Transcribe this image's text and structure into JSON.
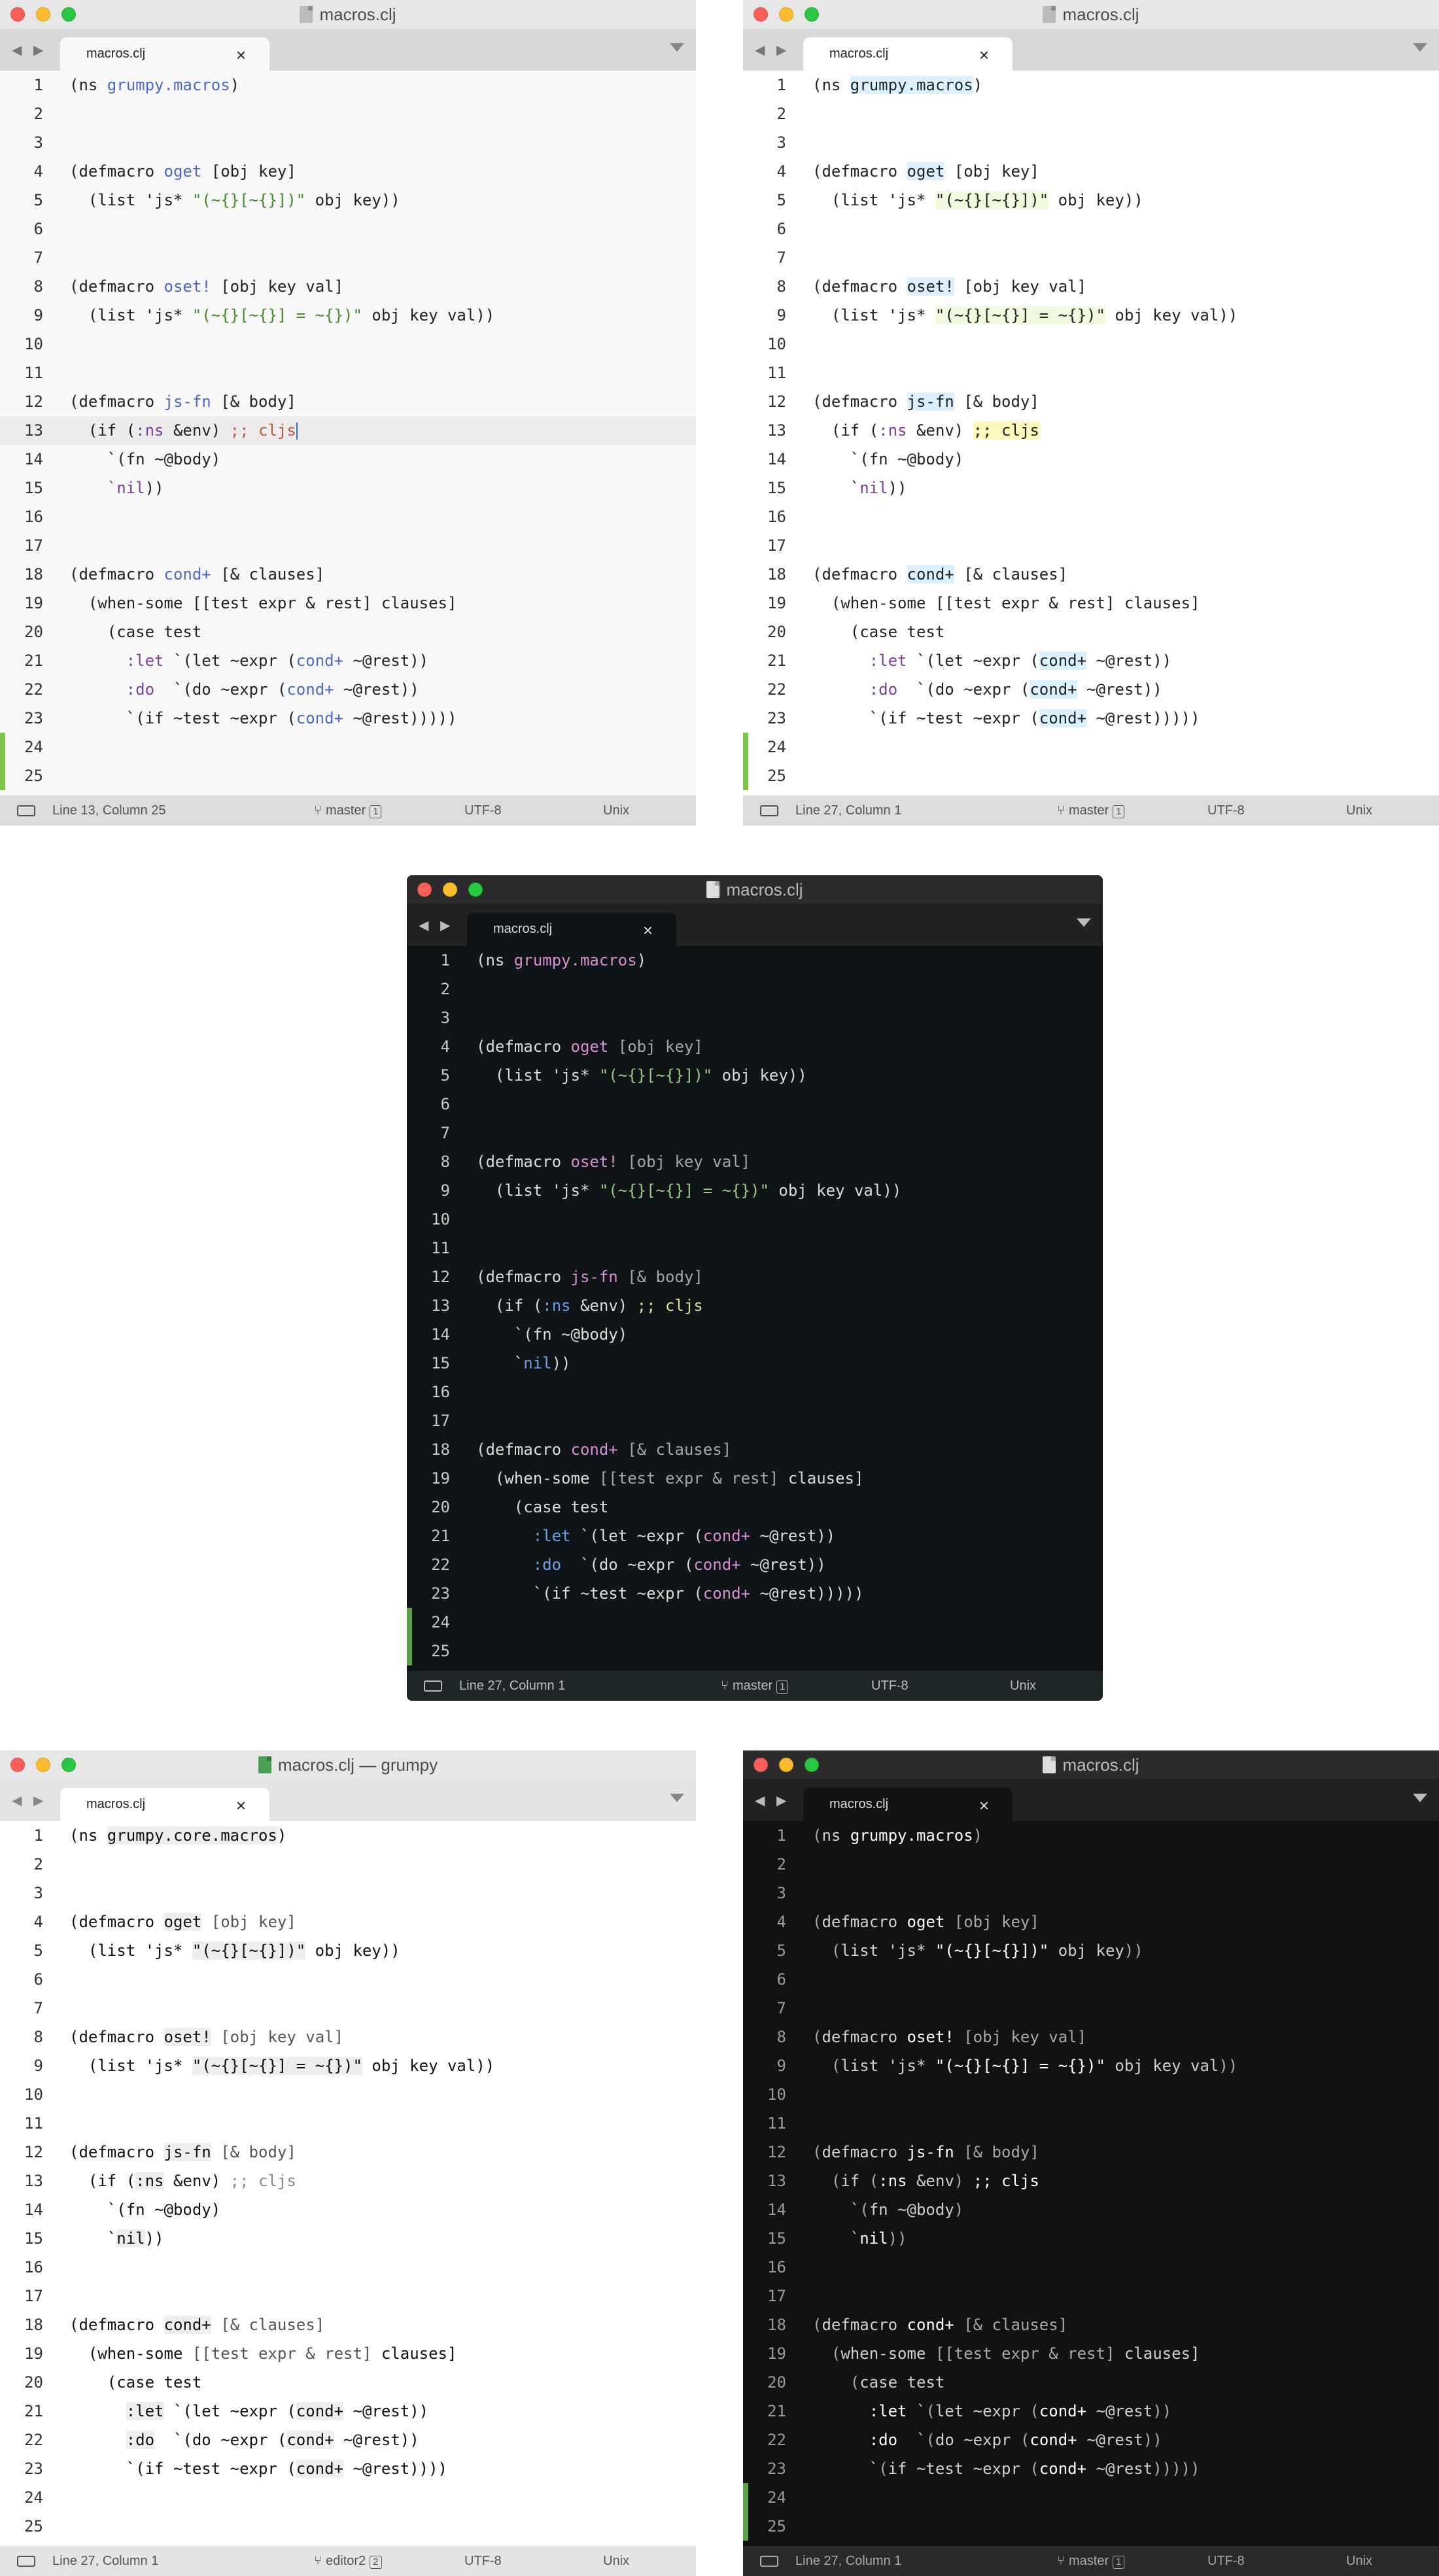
{
  "line_numbers": [
    "1",
    "2",
    "3",
    "4",
    "5",
    "6",
    "7",
    "8",
    "9",
    "10",
    "11",
    "12",
    "13",
    "14",
    "15",
    "16",
    "17",
    "18",
    "19",
    "20",
    "21",
    "22",
    "23",
    "24",
    "25"
  ],
  "code_default": [
    "(ns grumpy.macros)",
    "",
    "",
    "(defmacro oget [obj key]",
    "  (list 'js* \"(~{}[~{}])\" obj key))",
    "",
    "",
    "(defmacro oset! [obj key val]",
    "  (list 'js* \"(~{}[~{}] = ~{})\" obj key val))",
    "",
    "",
    "(defmacro js-fn [& body]",
    "  (if (:ns &env) ;; cljs",
    "    `(fn ~@body)",
    "    `nil))",
    "",
    "",
    "(defmacro cond+ [& clauses]",
    "  (when-some [[test expr & rest] clauses]",
    "    (case test",
    "      :let `(let ~expr (cond+ ~@rest))",
    "      :do  `(do ~expr (cond+ ~@rest))",
    "      `(if ~test ~expr (cond+ ~@rest)))))",
    "",
    ""
  ],
  "code_core_line1": "(ns grumpy.core.macros)",
  "code_core_line23": "      `(if ~test ~expr (cond+ ~@rest))))",
  "windows": [
    {
      "theme": "light-default",
      "title": "macros.clj",
      "tab_label": "macros.clj",
      "tab_close": "×",
      "status": {
        "position": "Line 13, Column 25",
        "branch": "master",
        "branch_count": "1",
        "encoding": "UTF-8",
        "line_endings": "Unix"
      },
      "colors": {
        "keyword": "#4b69c6",
        "string": "#448c27",
        "comment": "#c05a3a",
        "cursor": "#2f6fdb",
        "modified_bar": "#7ec24a"
      }
    },
    {
      "theme": "light-highlight",
      "title": "macros.clj",
      "tab_label": "macros.clj",
      "tab_close": "×",
      "status": {
        "position": "Line 27, Column 1",
        "branch": "master",
        "branch_count": "1",
        "encoding": "UTF-8",
        "line_endings": "Unix"
      },
      "colors": {
        "def_bg": "#dbf1ff",
        "string_bg": "#f1fadf",
        "comment_bg": "#fffabc",
        "modified_bar": "#7ec24a"
      }
    },
    {
      "theme": "dark",
      "title": "macros.clj",
      "tab_label": "macros.clj",
      "tab_close": "×",
      "status": {
        "position": "Line 27, Column 1",
        "branch": "master",
        "branch_count": "1",
        "encoding": "UTF-8",
        "line_endings": "Unix"
      },
      "colors": {
        "def": "#d98cd0",
        "string": "#95cb82",
        "comment": "#dfdf8e",
        "constant": "#68a1e6",
        "modified_bar": "#5ca04a"
      }
    },
    {
      "theme": "light-alabaster",
      "title": "macros.clj — grumpy",
      "tab_label": "macros.clj",
      "tab_close": "×",
      "status": {
        "position": "Line 27, Column 1",
        "branch": "editor2",
        "branch_count": "2",
        "encoding": "UTF-8",
        "line_endings": "Unix"
      },
      "colors": {
        "highlight_bg": "#eeeeee",
        "comment": "#8a8a8a"
      }
    },
    {
      "theme": "dark-alabaster",
      "title": "macros.clj",
      "tab_label": "macros.clj",
      "tab_close": "×",
      "status": {
        "position": "Line 27, Column 1",
        "branch": "master",
        "branch_count": "1",
        "encoding": "UTF-8",
        "line_endings": "Unix"
      },
      "colors": {
        "bright": "#ffffff",
        "dim": "#a8a8a8",
        "modified_bar": "#5ca04a"
      }
    }
  ],
  "icons": {
    "nav": "◀ ▶",
    "branch": "branch-icon",
    "panel": "panel-icon",
    "document": "document-icon"
  }
}
